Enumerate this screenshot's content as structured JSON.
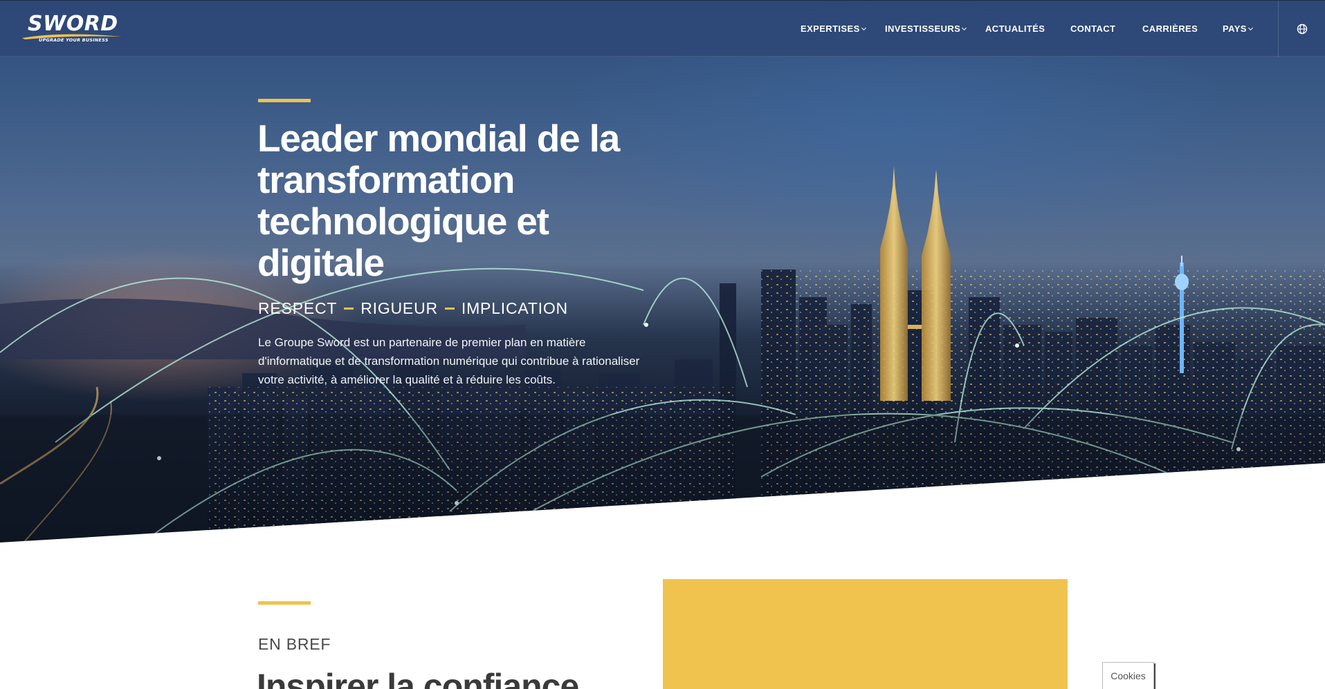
{
  "header": {
    "logo_text": "SWORD",
    "logo_tagline": "UPGRADE YOUR BUSINESS",
    "nav": [
      {
        "label": "EXPERTISES",
        "has_dropdown": true
      },
      {
        "label": "INVESTISSEURS",
        "has_dropdown": true
      },
      {
        "label": "ACTUALITÉS",
        "has_dropdown": false
      },
      {
        "label": "CONTACT",
        "has_dropdown": false
      },
      {
        "label": "CARRIÈRES",
        "has_dropdown": false
      },
      {
        "label": "PAYS",
        "has_dropdown": true
      }
    ],
    "language_icon": "globe-icon"
  },
  "hero": {
    "title": "Leader mondial de la transformation technologique et digitale",
    "values": [
      "RESPECT",
      "RIGUEUR",
      "IMPLICATION"
    ],
    "description": "Le Groupe Sword est un partenaire de premier plan en matière d'informatique et de transformation numérique qui contribue à rationaliser votre activité, à améliorer la qualité et à réduire les coûts."
  },
  "brief": {
    "label": "EN BREF",
    "heading": "Inspirer la confiance"
  },
  "cookies": {
    "label": "Cookies"
  },
  "colors": {
    "header_bg": "#2e4876",
    "accent": "#f0c24e",
    "yellow_panel": "#f0c34f",
    "text_dark": "#3a3a3a"
  }
}
